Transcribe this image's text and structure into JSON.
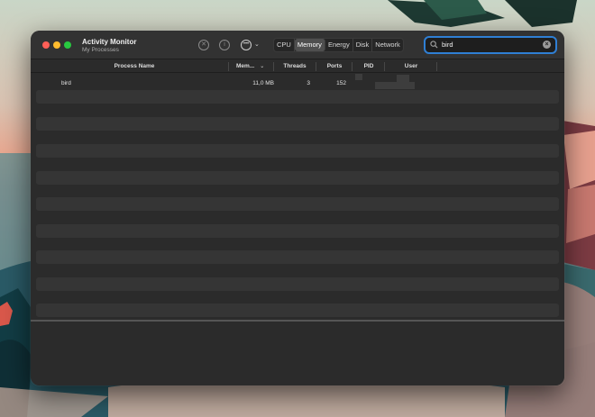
{
  "app": {
    "title": "Activity Monitor",
    "subtitle": "My Processes"
  },
  "toolbar": {
    "stop_icon": "stop-process-icon",
    "info_icon": "info-icon",
    "more_icon": "ellipsis-circle-icon",
    "tabs": [
      {
        "label": "CPU",
        "active": false
      },
      {
        "label": "Memory",
        "active": true
      },
      {
        "label": "Energy",
        "active": false
      },
      {
        "label": "Disk",
        "active": false
      },
      {
        "label": "Network",
        "active": false
      }
    ]
  },
  "search": {
    "value": "bird",
    "accent": "#2f7fd4"
  },
  "table": {
    "columns": [
      "Process Name",
      "Mem...",
      "Threads",
      "Ports",
      "PID",
      "User"
    ],
    "rows": [
      {
        "name": "bird",
        "memory": "11,0 MB",
        "threads": "3",
        "ports": "152",
        "pid": "",
        "user": ""
      }
    ]
  },
  "colors": {
    "close": "#ff5f57",
    "minimize": "#febc2e",
    "zoom": "#28c840"
  }
}
